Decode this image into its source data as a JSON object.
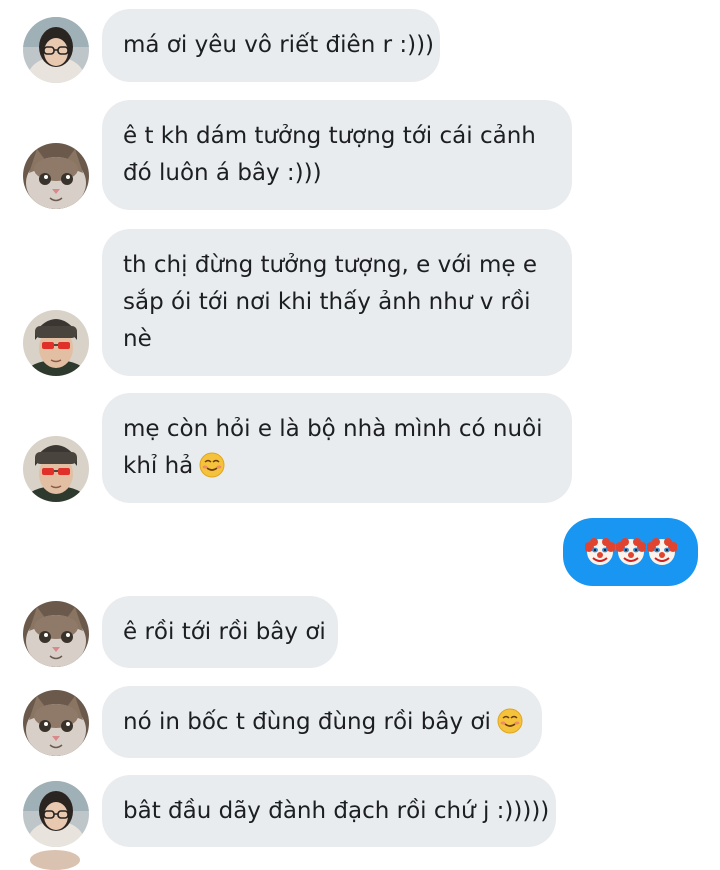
{
  "colors": {
    "incoming_bubble": "#e9ecef",
    "outgoing_bubble": "#1896f2",
    "text": "#1c1e21"
  },
  "messages": [
    {
      "sender": "girl-glasses",
      "lines": [
        "má ơi yêu vô riết điên r :)))"
      ],
      "emoji": ""
    },
    {
      "sender": "cat",
      "lines": [
        "ê t kh dám tưởng tượng tới cái cảnh",
        "đó luôn á bây :)))"
      ],
      "emoji": ""
    },
    {
      "sender": "boy-red-glasses",
      "lines": [
        "th chị đừng tưởng tượng, e với mẹ e",
        "sắp ói tới nơi khi thấy ảnh như v rồi",
        "nè"
      ],
      "emoji": ""
    },
    {
      "sender": "boy-red-glasses",
      "lines": [
        "mẹ còn hỏi e là bộ nhà mình có nuôi",
        "khỉ hả"
      ],
      "emoji": "smiling-face-icon"
    },
    {
      "sender": "me",
      "lines": [],
      "emoji": "clown-face-icon x3"
    },
    {
      "sender": "cat",
      "lines": [
        "ê rồi tới rồi bây ơi"
      ],
      "emoji": ""
    },
    {
      "sender": "cat",
      "lines": [
        "nó in bốc t đùng đùng rồi bây ơi"
      ],
      "emoji": "smiling-face-icon"
    },
    {
      "sender": "girl-glasses",
      "lines": [
        "bât đầu dãy đành đạch rồi chứ j :)))))"
      ],
      "emoji": ""
    }
  ]
}
